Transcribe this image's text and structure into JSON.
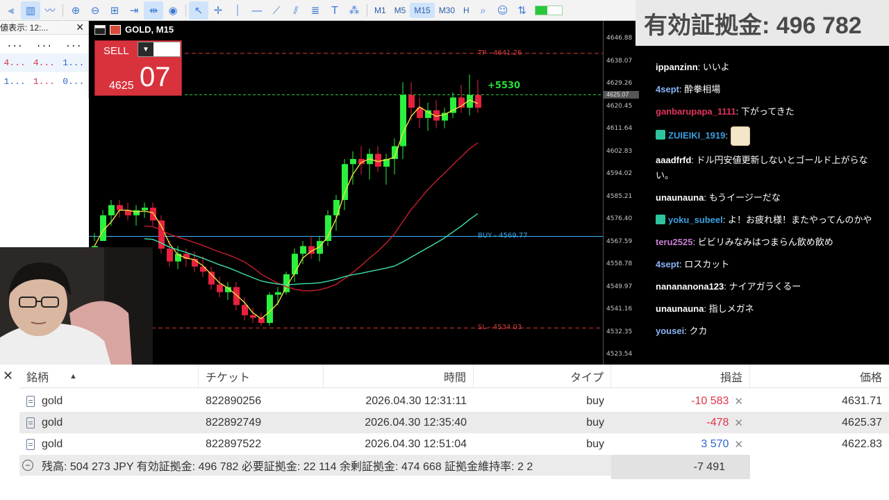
{
  "toolbar": {
    "timeframes": [
      "M1",
      "M5",
      "M15",
      "M30",
      "H"
    ]
  },
  "market_watch": {
    "tab_label": "値表示: 12:...",
    "rows": [
      [
        "...",
        "...",
        "..."
      ],
      [
        "4...",
        "4...",
        "1..."
      ],
      [
        "1...",
        "1...",
        "0..."
      ]
    ]
  },
  "chart": {
    "symbol": "GOLD, M15",
    "sell_label": "SELL",
    "sell_price_small": "4625",
    "sell_price_big": "07",
    "tp_label": "TP - 4641.26",
    "buy_label": "BUY - 4569.77",
    "sl_label": "SL - 4534.03",
    "profit_label": "+5530",
    "current_price": "4625.07",
    "price_ticks": [
      "4646.88",
      "4638.07",
      "4629.26",
      "4620.45",
      "4611.64",
      "4602.83",
      "4594.02",
      "4585.21",
      "4576.40",
      "4567.59",
      "4558.78",
      "4549.97",
      "4541.16",
      "4532.35",
      "4523.54"
    ]
  },
  "chart_data": {
    "type": "candlestick",
    "symbol": "GOLD",
    "timeframe": "M15",
    "ylim": [
      4523.54,
      4646.88
    ],
    "candles": [
      [
        4565,
        4571,
        4568,
        4566
      ],
      [
        4568,
        4580,
        4568,
        4578
      ],
      [
        4578,
        4584,
        4574,
        4582
      ],
      [
        4582,
        4584,
        4577,
        4580
      ],
      [
        4580,
        4583,
        4576,
        4578
      ],
      [
        4578,
        4582,
        4574,
        4580
      ],
      [
        4580,
        4583,
        4577,
        4581
      ],
      [
        4581,
        4583,
        4574,
        4576
      ],
      [
        4576,
        4578,
        4563,
        4565
      ],
      [
        4565,
        4568,
        4558,
        4560
      ],
      [
        4560,
        4566,
        4557,
        4563
      ],
      [
        4563,
        4565,
        4558,
        4561
      ],
      [
        4561,
        4564,
        4556,
        4558
      ],
      [
        4558,
        4562,
        4554,
        4556
      ],
      [
        4556,
        4558,
        4549,
        4551
      ],
      [
        4551,
        4554,
        4546,
        4548
      ],
      [
        4548,
        4552,
        4545,
        4550
      ],
      [
        4550,
        4552,
        4541,
        4543
      ],
      [
        4543,
        4546,
        4537,
        4539
      ],
      [
        4539,
        4542,
        4536,
        4538
      ],
      [
        4538,
        4540,
        4535,
        4536
      ],
      [
        4536,
        4548,
        4535,
        4547
      ],
      [
        4547,
        4550,
        4543,
        4548
      ],
      [
        4548,
        4556,
        4547,
        4555
      ],
      [
        4555,
        4565,
        4552,
        4563
      ],
      [
        4563,
        4568,
        4559,
        4566
      ],
      [
        4566,
        4570,
        4561,
        4563
      ],
      [
        4563,
        4570,
        4560,
        4568
      ],
      [
        4568,
        4580,
        4566,
        4578
      ],
      [
        4578,
        4586,
        4572,
        4584
      ],
      [
        4584,
        4600,
        4580,
        4598
      ],
      [
        4598,
        4603,
        4590,
        4600
      ],
      [
        4600,
        4605,
        4594,
        4598
      ],
      [
        4598,
        4604,
        4592,
        4602
      ],
      [
        4602,
        4605,
        4595,
        4597
      ],
      [
        4597,
        4602,
        4590,
        4600
      ],
      [
        4600,
        4608,
        4594,
        4605
      ],
      [
        4605,
        4630,
        4600,
        4625
      ],
      [
        4625,
        4630,
        4615,
        4620
      ],
      [
        4620,
        4624,
        4612,
        4616
      ],
      [
        4616,
        4622,
        4611,
        4619
      ],
      [
        4619,
        4623,
        4612,
        4615
      ],
      [
        4615,
        4620,
        4612,
        4618
      ],
      [
        4618,
        4626,
        4616,
        4624
      ],
      [
        4624,
        4629,
        4618,
        4620
      ],
      [
        4620,
        4633,
        4617,
        4625
      ],
      [
        4625,
        4631,
        4618,
        4620
      ]
    ],
    "levels": {
      "tp": 4641.26,
      "current": 4625.07,
      "buy": 4569.77,
      "sl": 4534.03
    }
  },
  "overlay": {
    "title": "有効証拠金: 496 782"
  },
  "chat": [
    {
      "name": "ippanzinn",
      "color": "#ffffff",
      "text": ": いいよ"
    },
    {
      "name": "4sept",
      "color": "#8ab4f8",
      "text": ": 酔拳相場"
    },
    {
      "name": "ganbarupapa_1111",
      "color": "#e0335a",
      "text": ": 下がってきた"
    },
    {
      "name": "ZUIEIKI_1919",
      "color": "#3aa1e0",
      "text": ": ",
      "gift": true,
      "emote": true
    },
    {
      "name": "aaadfrfd",
      "color": "#ffffff",
      "text": ": ドル円安値更新しないとゴールド上がらない。"
    },
    {
      "name": "unaunauna",
      "color": "#ffffff",
      "text": ": もうイージーだな"
    },
    {
      "name": "yoku_subeel",
      "color": "#3aa1e0",
      "text": ": よ！お疲れ様！またやってんのかや",
      "gift": true
    },
    {
      "name": "teru2525",
      "color": "#c77dd1",
      "text": ": ビビリみなみはつまらん飲め飲め"
    },
    {
      "name": "4sept",
      "color": "#8ab4f8",
      "text": ": ロスカット"
    },
    {
      "name": "nanananona123",
      "color": "#ffffff",
      "text": ": ナイアガラくるー"
    },
    {
      "name": "unaunauna",
      "color": "#ffffff",
      "text": ": 指しメガネ"
    },
    {
      "name": "yousei",
      "color": "#8ab4f8",
      "text": ": クカ"
    }
  ],
  "table": {
    "headers": [
      "銘柄",
      "チケット",
      "時間",
      "タイプ",
      "損益",
      "価格"
    ],
    "rows": [
      {
        "symbol": "gold",
        "ticket": "822890256",
        "time": "2026.04.30 12:31:11",
        "type": "buy",
        "pnl": "-10 583",
        "pnl_sign": "neg",
        "price": "4631.71"
      },
      {
        "symbol": "gold",
        "ticket": "822892749",
        "time": "2026.04.30 12:35:40",
        "type": "buy",
        "pnl": "-478",
        "pnl_sign": "neg",
        "price": "4625.37"
      },
      {
        "symbol": "gold",
        "ticket": "822897522",
        "time": "2026.04.30 12:51:04",
        "type": "buy",
        "pnl": "3 570",
        "pnl_sign": "pos",
        "price": "4622.83"
      }
    ],
    "summary": "残高: 504 273 JPY  有効証拠金: 496 782  必要証拠金: 22 114  余剰証拠金: 474 668  証拠金維持率: 2 2",
    "total": "-7 491"
  }
}
